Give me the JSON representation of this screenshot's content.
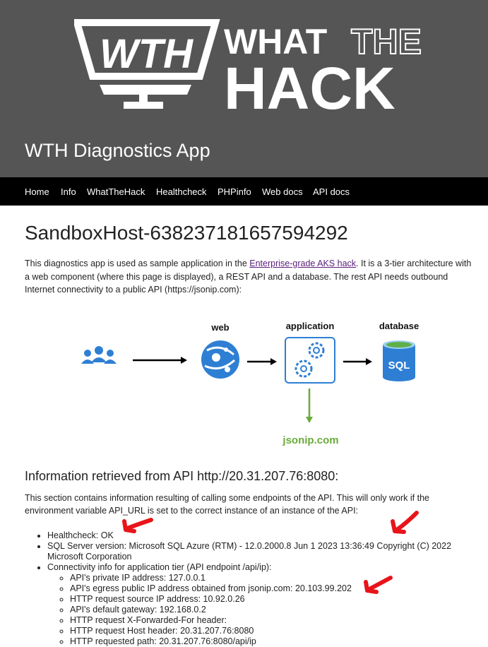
{
  "header": {
    "logo_text_1": "WHAT",
    "logo_text_2": "THE",
    "logo_text_3": "HACK",
    "logo_badge": "WTH",
    "app_title": "WTH Diagnostics App"
  },
  "nav": {
    "items": [
      {
        "label": "Home"
      },
      {
        "label": "Info"
      },
      {
        "label": "WhatTheHack"
      },
      {
        "label": "Healthcheck"
      },
      {
        "label": "PHPinfo"
      },
      {
        "label": "Web docs"
      },
      {
        "label": "API docs"
      }
    ]
  },
  "main": {
    "host_title": "SandboxHost-638237181657594292",
    "intro_before_link": "This diagnostics app is used as sample application in the ",
    "intro_link": "Enterprise-grade AKS hack",
    "intro_after_link": ". It is a 3-tier architecture with a web component (where this page is displayed), a REST API and a database. The rest API needs outbound Internet connectivity to a public API (https://jsonip.com):"
  },
  "diagram": {
    "web_label": "web",
    "application_label": "application",
    "database_label": "database",
    "sql_label": "SQL",
    "external_label": "jsonip.com",
    "colors": {
      "blue": "#2e7fd4",
      "green": "#6aaa3a"
    }
  },
  "api": {
    "heading": "Information retrieved from API http://20.31.207.76:8080:",
    "description": "This section contains information resulting of calling some endpoints of the API. This will only work if the environment variable API_URL is set to the correct instance of an instance of the API:",
    "items": [
      "Healthcheck: OK",
      "SQL Server version: Microsoft SQL Azure (RTM) - 12.0.2000.8 Jun 1 2023 13:36:49 Copyright (C) 2022 Microsoft Corporation",
      "Connectivity info for application tier (API endpoint /api/ip):"
    ],
    "sub_items": [
      "API's private IP address: 127.0.0.1",
      "API's egress public IP address obtained from jsonip.com: 20.103.99.202",
      "HTTP request source IP address: 10.92.0.26",
      "API's default gateway: 192.168.0.2",
      "HTTP request X-Forwarded-For header:",
      "HTTP request Host header: 20.31.207.76:8080",
      "HTTP requested path: 20.31.207.76:8080/api/ip"
    ]
  },
  "annotations": {
    "arrow_color": "#e8141b"
  }
}
